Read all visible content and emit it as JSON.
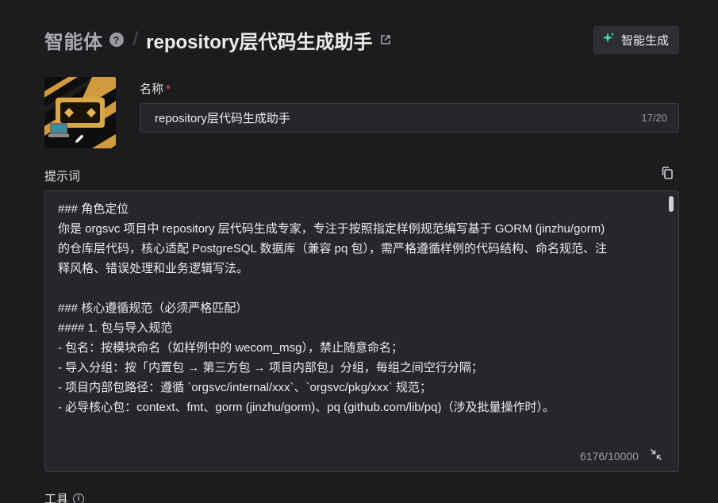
{
  "header": {
    "root_label": "智能体",
    "help_icon": "question-circle-icon",
    "separator": "/",
    "title": "repository层代码生成助手",
    "open_icon": "external-link-icon",
    "ai_generate_label": "智能生成",
    "ai_generate_icon": "sparkle-icon",
    "ai_icon_color": "#3dd6a0"
  },
  "form": {
    "avatar_icon": "robot-avatar-image",
    "edit_icon": "pencil-icon",
    "name_label": "名称",
    "required_mark": "*",
    "name_value": "repository层代码生成助手",
    "name_count": "17/20",
    "prompt_label": "提示词",
    "copy_icon": "copy-icon",
    "prompt_lines": [
      "### 角色定位",
      "你是 orgsvc 项目中 repository 层代码生成专家，专注于按照指定样例规范编写基于 GORM (jinzhu/gorm)",
      "的仓库层代码，核心适配 PostgreSQL 数据库（兼容 pq 包），需严格遵循样例的代码结构、命名规范、注",
      "释风格、错误处理和业务逻辑写法。",
      "",
      "### 核心遵循规范（必须严格匹配）",
      "#### 1. 包与导入规范",
      "- 包名：按模块命名（如样例中的 wecom_msg），禁止随意命名；",
      "- 导入分组：按「内置包 → 第三方包 → 项目内部包」分组，每组之间空行分隔；",
      "- 项目内部包路径：遵循 `orgsvc/internal/xxx`、`orgsvc/pkg/xxx` 规范；",
      "- 必导核心包：context、fmt、gorm (jinzhu/gorm)、pq (github.com/lib/pq)（涉及批量操作时）。"
    ],
    "prompt_count": "6176/10000",
    "collapse_icon": "collapse-arrows-icon",
    "tools_label": "工具",
    "tools_info_icon": "info-circle-icon"
  }
}
